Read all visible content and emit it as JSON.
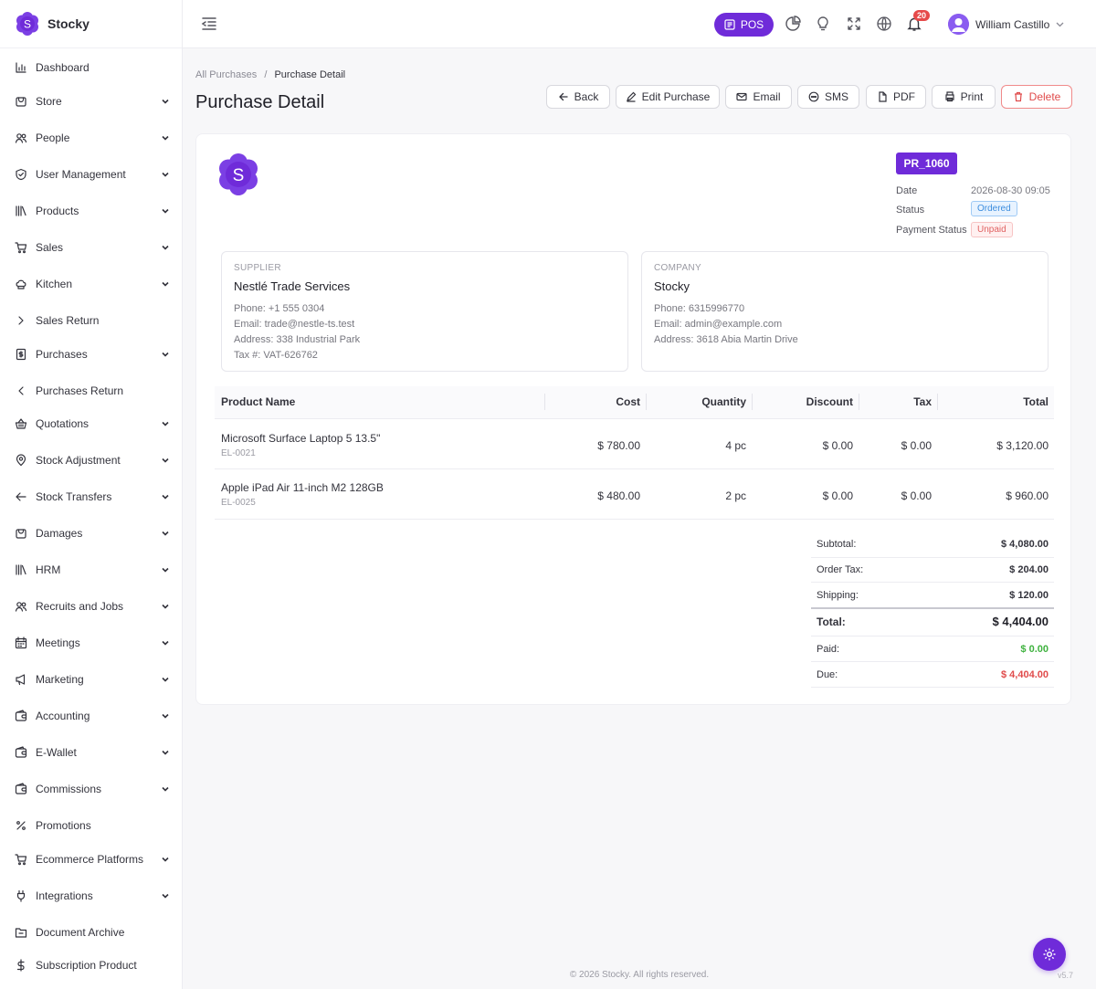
{
  "brand": {
    "name": "Stocky",
    "logo_letter": "S"
  },
  "sidebar": {
    "items": [
      {
        "label": "Dashboard",
        "icon": "bar-chart-icon",
        "expandable": false
      },
      {
        "label": "Store",
        "icon": "store-icon",
        "expandable": true
      },
      {
        "label": "People",
        "icon": "people-icon",
        "expandable": true
      },
      {
        "label": "User Management",
        "icon": "shield-icon",
        "expandable": true
      },
      {
        "label": "Products",
        "icon": "books-icon",
        "expandable": true
      },
      {
        "label": "Sales",
        "icon": "cart-icon",
        "expandable": true
      },
      {
        "label": "Kitchen",
        "icon": "chef-hat-icon",
        "expandable": true
      },
      {
        "label": "Sales Return",
        "icon": "chevron-right-icon",
        "expandable": false
      },
      {
        "label": "Purchases",
        "icon": "receipt-icon",
        "expandable": true
      },
      {
        "label": "Purchases Return",
        "icon": "chevron-left-icon",
        "expandable": false
      },
      {
        "label": "Quotations",
        "icon": "basket-icon",
        "expandable": true
      },
      {
        "label": "Stock Adjustment",
        "icon": "location-pin-icon",
        "expandable": true
      },
      {
        "label": "Stock Transfers",
        "icon": "arrow-left-icon",
        "expandable": true
      },
      {
        "label": "Damages",
        "icon": "bag-icon",
        "expandable": true
      },
      {
        "label": "HRM",
        "icon": "library-icon",
        "expandable": true
      },
      {
        "label": "Recruits and Jobs",
        "icon": "people-icon",
        "expandable": true
      },
      {
        "label": "Meetings",
        "icon": "calendar-icon",
        "expandable": true
      },
      {
        "label": "Marketing",
        "icon": "megaphone-icon",
        "expandable": true
      },
      {
        "label": "Accounting",
        "icon": "wallet-icon",
        "expandable": true
      },
      {
        "label": "E-Wallet",
        "icon": "wallet-icon",
        "expandable": true
      },
      {
        "label": "Commissions",
        "icon": "wallet-icon",
        "expandable": true
      },
      {
        "label": "Promotions",
        "icon": "percent-icon",
        "expandable": false
      },
      {
        "label": "Ecommerce Platforms",
        "icon": "cart-icon",
        "expandable": true
      },
      {
        "label": "Integrations",
        "icon": "plug-icon",
        "expandable": true
      },
      {
        "label": "Document Archive",
        "icon": "folder-icon",
        "expandable": false
      },
      {
        "label": "Subscription Product",
        "icon": "dollar-icon",
        "expandable": false
      }
    ]
  },
  "topbar": {
    "pos_label": "POS",
    "notification_count": "20",
    "user_name": "William Castillo"
  },
  "breadcrumb": {
    "parent": "All Purchases",
    "separator": "/",
    "current": "Purchase Detail"
  },
  "page": {
    "title": "Purchase Detail"
  },
  "actions": {
    "back": "Back",
    "edit": "Edit Purchase",
    "email": "Email",
    "sms": "SMS",
    "pdf": "PDF",
    "print": "Print",
    "delete": "Delete"
  },
  "purchase": {
    "ref": "PR_1060",
    "date_label": "Date",
    "date": "2026-08-30 09:05",
    "status_label": "Status",
    "status": "Ordered",
    "payment_status_label": "Payment Status",
    "payment_status": "Unpaid"
  },
  "supplier": {
    "kicker": "SUPPLIER",
    "name": "Nestlé Trade Services",
    "phone": "Phone: +1 555 0304",
    "email": "Email: trade@nestle-ts.test",
    "address": "Address: 338 Industrial Park",
    "tax": "Tax #: VAT-626762"
  },
  "company": {
    "kicker": "COMPANY",
    "name": "Stocky",
    "phone": "Phone: 6315996770",
    "email": "Email: admin@example.com",
    "address": "Address: 3618 Abia Martin Drive"
  },
  "table": {
    "headers": [
      "Product Name",
      "Cost",
      "Quantity",
      "Discount",
      "Tax",
      "Total"
    ],
    "rows": [
      {
        "name": "Microsoft Surface Laptop 5 13.5\"",
        "sku": "EL-0021",
        "cost": "$ 780.00",
        "qty": "4 pc",
        "discount": "$ 0.00",
        "tax": "$ 0.00",
        "total": "$ 3,120.00"
      },
      {
        "name": "Apple iPad Air 11-inch M2 128GB",
        "sku": "EL-0025",
        "cost": "$ 480.00",
        "qty": "2 pc",
        "discount": "$ 0.00",
        "tax": "$ 0.00",
        "total": "$ 960.00"
      }
    ]
  },
  "summary": {
    "subtotal_label": "Subtotal:",
    "subtotal": "$ 4,080.00",
    "order_tax_label": "Order Tax:",
    "order_tax": "$ 204.00",
    "shipping_label": "Shipping:",
    "shipping": "$ 120.00",
    "total_label": "Total:",
    "total": "$ 4,404.00",
    "paid_label": "Paid:",
    "paid": "$ 0.00",
    "due_label": "Due:",
    "due": "$ 4,404.00"
  },
  "footer": {
    "copyright": "© 2026 Stocky. All rights reserved.",
    "version": "v5.7"
  },
  "colors": {
    "accent": "#6f2bd9",
    "danger": "#e04b4b",
    "success": "#3fb23f",
    "info": "#3c8dde"
  }
}
